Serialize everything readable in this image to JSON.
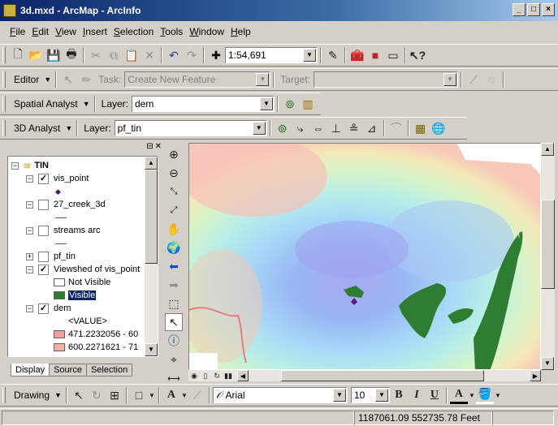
{
  "window": {
    "title": "3d.mxd - ArcMap - ArcInfo"
  },
  "menu": [
    "File",
    "Edit",
    "View",
    "Insert",
    "Selection",
    "Tools",
    "Window",
    "Help"
  ],
  "standard_toolbar": {
    "scale": "1:54,691"
  },
  "editor_toolbar": {
    "editor_label": "Editor",
    "task_label": "Task:",
    "task_value": "Create New Feature",
    "target_label": "Target:"
  },
  "spatial_analyst": {
    "title": "Spatial Analyst",
    "layer_label": "Layer:",
    "layer_value": "dem"
  },
  "analyst_3d": {
    "title": "3D Analyst",
    "layer_label": "Layer:",
    "layer_value": "pf_tin"
  },
  "toc": {
    "root": "TIN",
    "layers": [
      {
        "name": "vis_point",
        "checked": true,
        "expanded": true
      },
      {
        "name": "27_creek_3d",
        "checked": false,
        "expanded": true
      },
      {
        "name": "streams arc",
        "checked": false,
        "expanded": true
      },
      {
        "name": "pf_tin",
        "checked": false,
        "expanded": false
      },
      {
        "name": "Viewshed of vis_point",
        "checked": true,
        "expanded": true
      },
      {
        "name": "dem",
        "checked": true,
        "expanded": true
      }
    ],
    "viewshed_legend": [
      "Not Visible",
      "Visible"
    ],
    "dem_legend_header": "<VALUE>",
    "dem_legend": [
      "471.2232056 - 60",
      "600.2271621 - 71"
    ],
    "tabs": [
      "Display",
      "Source",
      "Selection"
    ]
  },
  "drawing_toolbar": {
    "label": "Drawing",
    "font": "Arial",
    "size": "10",
    "bold": "B",
    "italic": "I",
    "underline": "U",
    "font_color_glyph": "A"
  },
  "status": {
    "coords": "1187061.09  552735.78 Feet"
  },
  "colors": {
    "titlebar": "#0a246a",
    "visible_green": "#2e7d32",
    "face": "#d4d0c8"
  }
}
